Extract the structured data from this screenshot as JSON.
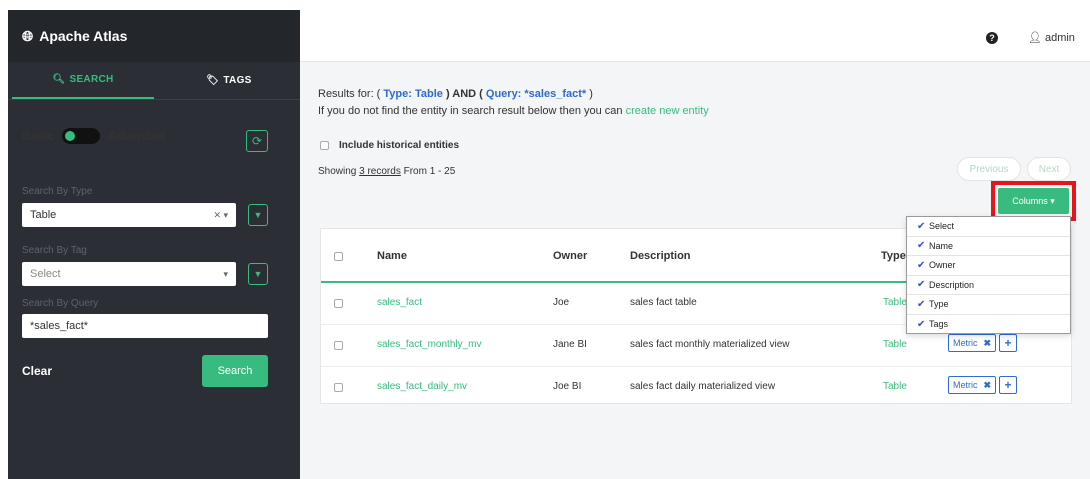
{
  "app": {
    "title": "Apache Atlas"
  },
  "sidebar": {
    "tabs": [
      {
        "label": "SEARCH",
        "icon": "search-icon"
      },
      {
        "label": "TAGS",
        "icon": "tag-icon"
      }
    ],
    "mode": {
      "basic": "Basic",
      "advanced": "Advanced",
      "help_glyph": "ⓘ"
    },
    "type_label": "Search By Type",
    "type_value": "Table",
    "tag_label": "Search By Tag",
    "tag_placeholder": "Select",
    "query_label": "Search By Query",
    "query_value": "*sales_fact*",
    "clear_label": "Clear",
    "search_label": "Search"
  },
  "header": {
    "user": "admin"
  },
  "results": {
    "prefix": "Results for: ( ",
    "type_part": "Type: Table",
    "mid": " ) AND ( ",
    "query_part": "Query: *sales_fact*",
    "suffix": " )",
    "hint_prefix": "If you do not find the entity in search result below then you can ",
    "hint_link": "create new entity",
    "historical_label": "Include historical entities",
    "showing_prefix": "Showing ",
    "records_link": "3 records",
    "showing_suffix": " From 1 - 25",
    "previous": "Previous",
    "next": "Next",
    "columns_button": "Columns ▾"
  },
  "table": {
    "headers": {
      "name": "Name",
      "owner": "Owner",
      "description": "Description",
      "type": "Type"
    },
    "rows": [
      {
        "name": "sales_fact",
        "owner": "Joe",
        "description": "sales fact table",
        "type": "Table",
        "tag": ""
      },
      {
        "name": "sales_fact_monthly_mv",
        "owner": "Jane BI",
        "description": "sales fact monthly materialized view",
        "type": "Table",
        "tag": "Metric"
      },
      {
        "name": "sales_fact_daily_mv",
        "owner": "Joe BI",
        "description": "sales fact daily materialized view",
        "type": "Table",
        "tag": "Metric"
      }
    ]
  },
  "columns_menu": [
    "Select",
    "Name",
    "Owner",
    "Description",
    "Type",
    "Tags"
  ],
  "colors": {
    "accent": "#38bb7f",
    "sidebar_bg": "#2b2f35",
    "link_blue": "#2f6bd0",
    "highlight_red": "#e8141a"
  }
}
